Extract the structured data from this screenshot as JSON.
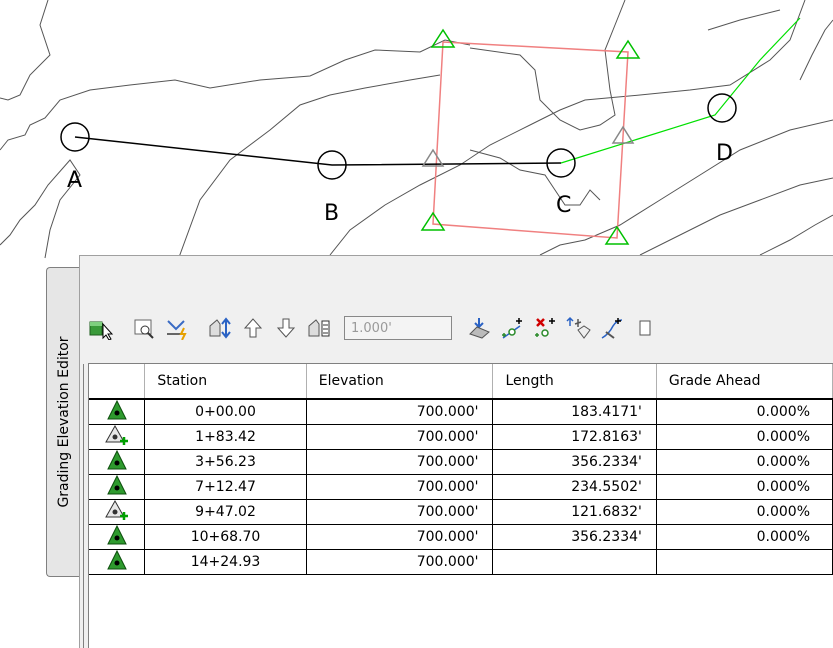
{
  "points": [
    {
      "label": "A"
    },
    {
      "label": "B"
    },
    {
      "label": "C"
    },
    {
      "label": "D"
    }
  ],
  "palette": {
    "title": "Grading Elevation Editor",
    "elevation_input": "1.000'",
    "columns": [
      "",
      "Station",
      "Elevation",
      "Length",
      "Grade Ahead"
    ],
    "rows": [
      {
        "icon": "grade-point-icon",
        "station": "0+00.00",
        "elevation": "700.000'",
        "length": "183.4171'",
        "grade": "0.000%"
      },
      {
        "icon": "grade-break-point-icon",
        "station": "1+83.42",
        "elevation": "700.000'",
        "length": "172.8163'",
        "grade": "0.000%"
      },
      {
        "icon": "grade-point-icon",
        "station": "3+56.23",
        "elevation": "700.000'",
        "length": "356.2334'",
        "grade": "0.000%"
      },
      {
        "icon": "grade-point-icon",
        "station": "7+12.47",
        "elevation": "700.000'",
        "length": "234.5502'",
        "grade": "0.000%"
      },
      {
        "icon": "grade-break-point-icon",
        "station": "9+47.02",
        "elevation": "700.000'",
        "length": "121.6832'",
        "grade": "0.000%"
      },
      {
        "icon": "grade-point-icon",
        "station": "10+68.70",
        "elevation": "700.000'",
        "length": "356.2334'",
        "grade": "0.000%"
      },
      {
        "icon": "grade-point-icon",
        "station": "14+24.93",
        "elevation": "700.000'",
        "length": "",
        "grade": ""
      }
    ]
  },
  "colors": {
    "selection_box": "#f08080",
    "grip": "#00c000",
    "feature_line": "#00e000",
    "contour": "#555555"
  }
}
